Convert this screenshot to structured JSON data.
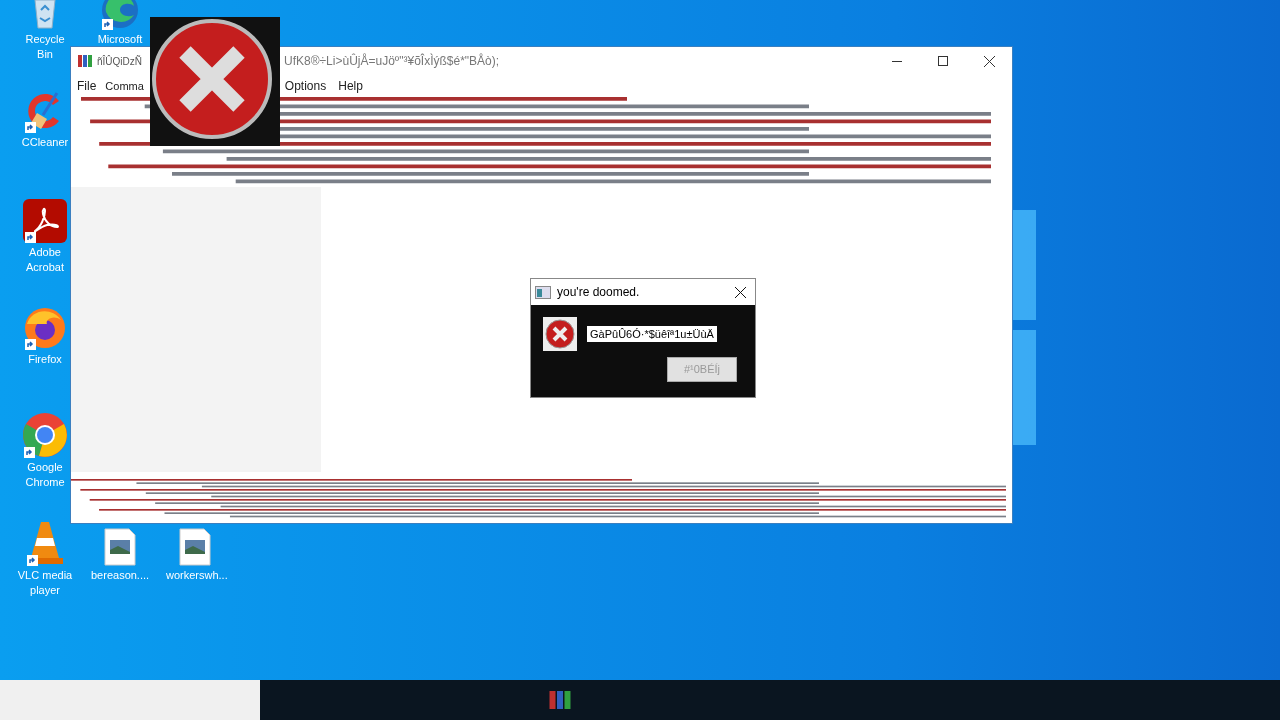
{
  "desktop_icons": [
    {
      "label": "Recycle Bin",
      "kind": "recycle",
      "shortcut": false
    },
    {
      "label": "Microsoft",
      "kind": "edge",
      "shortcut": true
    },
    {
      "label": "CCleaner",
      "kind": "ccleaner",
      "shortcut": true
    },
    {
      "label": "Adobe Acrobat",
      "kind": "acrobat",
      "shortcut": true
    },
    {
      "label": "Firefox",
      "kind": "firefox",
      "shortcut": true
    },
    {
      "label": "Google Chrome",
      "kind": "chrome",
      "shortcut": true
    },
    {
      "label": "VLC media player",
      "kind": "vlc",
      "shortcut": true
    },
    {
      "label": "bereason....",
      "kind": "image",
      "shortcut": false
    },
    {
      "label": "workerswh...",
      "kind": "image",
      "shortcut": false
    }
  ],
  "window": {
    "title_start": "ñÎÛQiDzÑ",
    "title_end": "UfK8®÷Li>ùÛjÅ=uJöº\"³¥õÎxÌýß$é*\"BÅò);",
    "menu": [
      "File",
      "Comma",
      "Options",
      "Help"
    ]
  },
  "dialog": {
    "title": "you're doomed.",
    "message": "GàPûÛ6Ó·*$üêîª1u±ÜùÄ",
    "button": "#¹0BÉÍj"
  }
}
